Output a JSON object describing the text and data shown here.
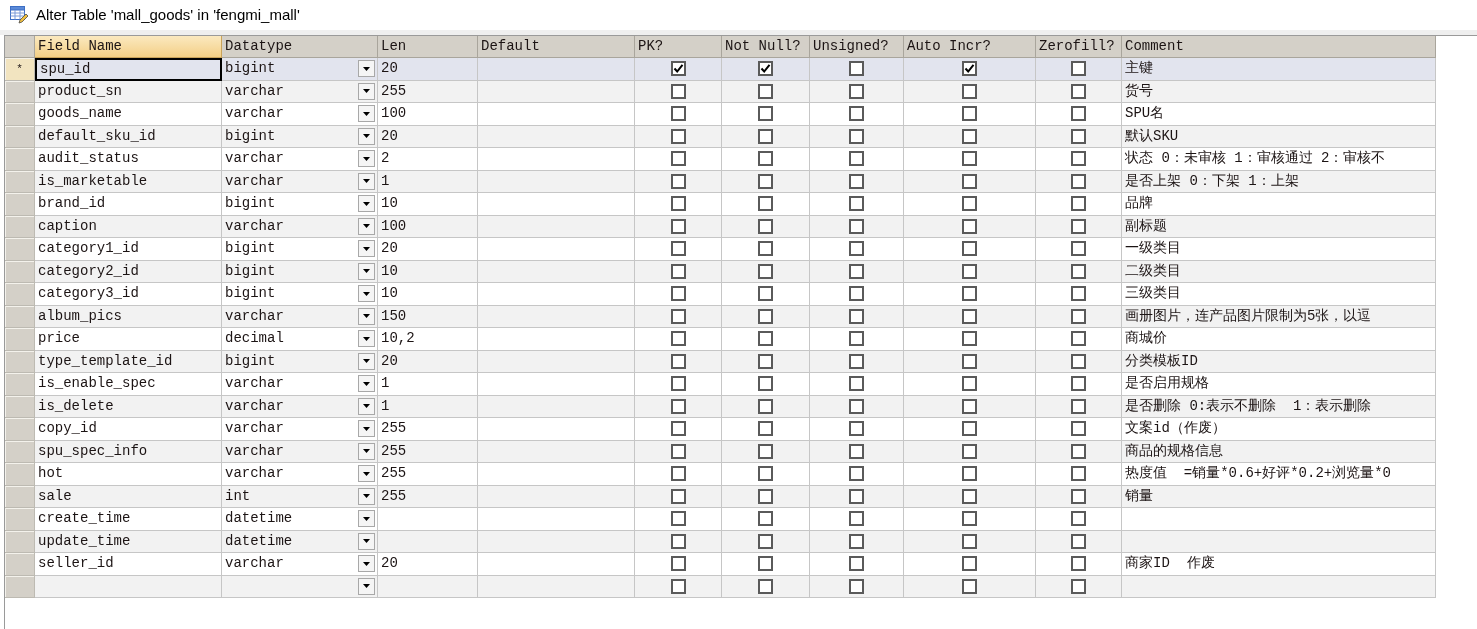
{
  "window": {
    "title": "Alter Table 'mall_goods' in 'fengmi_mall'"
  },
  "grid": {
    "current_row_marker": "*",
    "columns": [
      {
        "label": "Field Name",
        "selected": true
      },
      {
        "label": "Datatype",
        "selected": false
      },
      {
        "label": "Len",
        "selected": false
      },
      {
        "label": "Default",
        "selected": false
      },
      {
        "label": "PK?",
        "selected": false
      },
      {
        "label": "Not Null?",
        "selected": false
      },
      {
        "label": "Unsigned?",
        "selected": false
      },
      {
        "label": "Auto Incr?",
        "selected": false
      },
      {
        "label": "Zerofill?",
        "selected": false
      },
      {
        "label": "Comment",
        "selected": false
      }
    ],
    "rows": [
      {
        "selected": true,
        "field": "spu_id",
        "datatype": "bigint",
        "len": "20",
        "pk": true,
        "not_null": true,
        "unsigned": false,
        "auto_incr": true,
        "zerofill": false,
        "comment": "主键"
      },
      {
        "selected": false,
        "field": "product_sn",
        "datatype": "varchar",
        "len": "255",
        "pk": false,
        "not_null": false,
        "unsigned": false,
        "auto_incr": false,
        "zerofill": false,
        "comment": "货号"
      },
      {
        "selected": false,
        "field": "goods_name",
        "datatype": "varchar",
        "len": "100",
        "pk": false,
        "not_null": false,
        "unsigned": false,
        "auto_incr": false,
        "zerofill": false,
        "comment": "SPU名"
      },
      {
        "selected": false,
        "field": "default_sku_id",
        "datatype": "bigint",
        "len": "20",
        "pk": false,
        "not_null": false,
        "unsigned": false,
        "auto_incr": false,
        "zerofill": false,
        "comment": "默认SKU"
      },
      {
        "selected": false,
        "field": "audit_status",
        "datatype": "varchar",
        "len": "2",
        "pk": false,
        "not_null": false,
        "unsigned": false,
        "auto_incr": false,
        "zerofill": false,
        "comment": "状态 0：未审核 1：审核通过 2：审核不"
      },
      {
        "selected": false,
        "field": "is_marketable",
        "datatype": "varchar",
        "len": "1",
        "pk": false,
        "not_null": false,
        "unsigned": false,
        "auto_incr": false,
        "zerofill": false,
        "comment": "是否上架 0：下架 1：上架"
      },
      {
        "selected": false,
        "field": "brand_id",
        "datatype": "bigint",
        "len": "10",
        "pk": false,
        "not_null": false,
        "unsigned": false,
        "auto_incr": false,
        "zerofill": false,
        "comment": "品牌"
      },
      {
        "selected": false,
        "field": "caption",
        "datatype": "varchar",
        "len": "100",
        "pk": false,
        "not_null": false,
        "unsigned": false,
        "auto_incr": false,
        "zerofill": false,
        "comment": "副标题"
      },
      {
        "selected": false,
        "field": "category1_id",
        "datatype": "bigint",
        "len": "20",
        "pk": false,
        "not_null": false,
        "unsigned": false,
        "auto_incr": false,
        "zerofill": false,
        "comment": "一级类目"
      },
      {
        "selected": false,
        "field": "category2_id",
        "datatype": "bigint",
        "len": "10",
        "pk": false,
        "not_null": false,
        "unsigned": false,
        "auto_incr": false,
        "zerofill": false,
        "comment": "二级类目"
      },
      {
        "selected": false,
        "field": "category3_id",
        "datatype": "bigint",
        "len": "10",
        "pk": false,
        "not_null": false,
        "unsigned": false,
        "auto_incr": false,
        "zerofill": false,
        "comment": "三级类目"
      },
      {
        "selected": false,
        "field": "album_pics",
        "datatype": "varchar",
        "len": "150",
        "pk": false,
        "not_null": false,
        "unsigned": false,
        "auto_incr": false,
        "zerofill": false,
        "comment": "画册图片，连产品图片限制为5张，以逗"
      },
      {
        "selected": false,
        "field": "price",
        "datatype": "decimal",
        "len": "10,2",
        "pk": false,
        "not_null": false,
        "unsigned": false,
        "auto_incr": false,
        "zerofill": false,
        "comment": "商城价"
      },
      {
        "selected": false,
        "field": "type_template_id",
        "datatype": "bigint",
        "len": "20",
        "pk": false,
        "not_null": false,
        "unsigned": false,
        "auto_incr": false,
        "zerofill": false,
        "comment": "分类模板ID"
      },
      {
        "selected": false,
        "field": "is_enable_spec",
        "datatype": "varchar",
        "len": "1",
        "pk": false,
        "not_null": false,
        "unsigned": false,
        "auto_incr": false,
        "zerofill": false,
        "comment": "是否启用规格"
      },
      {
        "selected": false,
        "field": "is_delete",
        "datatype": "varchar",
        "len": "1",
        "pk": false,
        "not_null": false,
        "unsigned": false,
        "auto_incr": false,
        "zerofill": false,
        "comment": "是否删除 0:表示不删除  1：表示删除"
      },
      {
        "selected": false,
        "field": "copy_id",
        "datatype": "varchar",
        "len": "255",
        "pk": false,
        "not_null": false,
        "unsigned": false,
        "auto_incr": false,
        "zerofill": false,
        "comment": "文案id（作废）"
      },
      {
        "selected": false,
        "field": "spu_spec_info",
        "datatype": "varchar",
        "len": "255",
        "pk": false,
        "not_null": false,
        "unsigned": false,
        "auto_incr": false,
        "zerofill": false,
        "comment": "商品的规格信息"
      },
      {
        "selected": false,
        "field": "hot",
        "datatype": "varchar",
        "len": "255",
        "pk": false,
        "not_null": false,
        "unsigned": false,
        "auto_incr": false,
        "zerofill": false,
        "comment": "热度值  =销量*0.6+好评*0.2+浏览量*0"
      },
      {
        "selected": false,
        "field": "sale",
        "datatype": "int",
        "len": "255",
        "pk": false,
        "not_null": false,
        "unsigned": false,
        "auto_incr": false,
        "zerofill": false,
        "comment": "销量"
      },
      {
        "selected": false,
        "field": "create_time",
        "datatype": "datetime",
        "pk": false,
        "not_null": false,
        "unsigned": false,
        "auto_incr": false,
        "zerofill": false
      },
      {
        "selected": false,
        "field": "update_time",
        "datatype": "datetime",
        "pk": false,
        "not_null": false,
        "unsigned": false,
        "auto_incr": false,
        "zerofill": false
      },
      {
        "selected": false,
        "field": "seller_id",
        "datatype": "varchar",
        "len": "20",
        "pk": false,
        "not_null": false,
        "unsigned": false,
        "auto_incr": false,
        "zerofill": false,
        "comment": "商家ID  作废"
      },
      {
        "selected": false,
        "pk": false,
        "not_null": false,
        "unsigned": false,
        "auto_incr": false,
        "zerofill": false
      }
    ]
  }
}
